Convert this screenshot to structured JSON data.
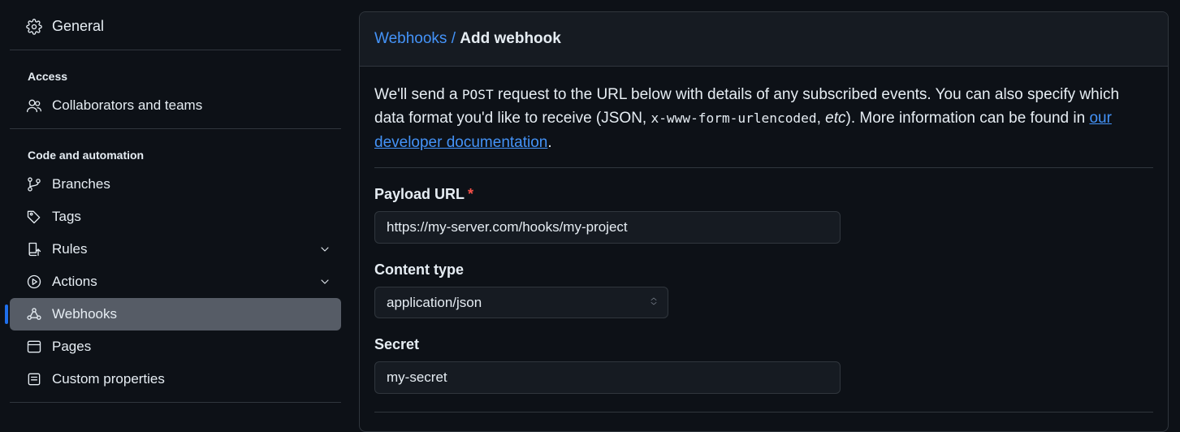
{
  "sidebar": {
    "general": "General",
    "access_heading": "Access",
    "collaborators": "Collaborators and teams",
    "code_heading": "Code and automation",
    "branches": "Branches",
    "tags": "Tags",
    "rules": "Rules",
    "actions": "Actions",
    "webhooks": "Webhooks",
    "pages": "Pages",
    "custom_props": "Custom properties"
  },
  "breadcrumb": {
    "parent": "Webhooks",
    "sep": " / ",
    "current": "Add webhook"
  },
  "intro": {
    "t1": "We'll send a ",
    "code1": "POST",
    "t2": " request to the URL below with details of any subscribed events. You can also specify which data format you'd like to receive (JSON, ",
    "code2": "x-www-form-urlencoded",
    "t3": ", ",
    "em": "etc",
    "t4": "). More information can be found in ",
    "link": "our developer documentation",
    "t5": "."
  },
  "form": {
    "payload_label": "Payload URL",
    "payload_value": "https://my-server.com/hooks/my-project",
    "content_label": "Content type",
    "content_value": "application/json",
    "secret_label": "Secret",
    "secret_value": "my-secret"
  }
}
